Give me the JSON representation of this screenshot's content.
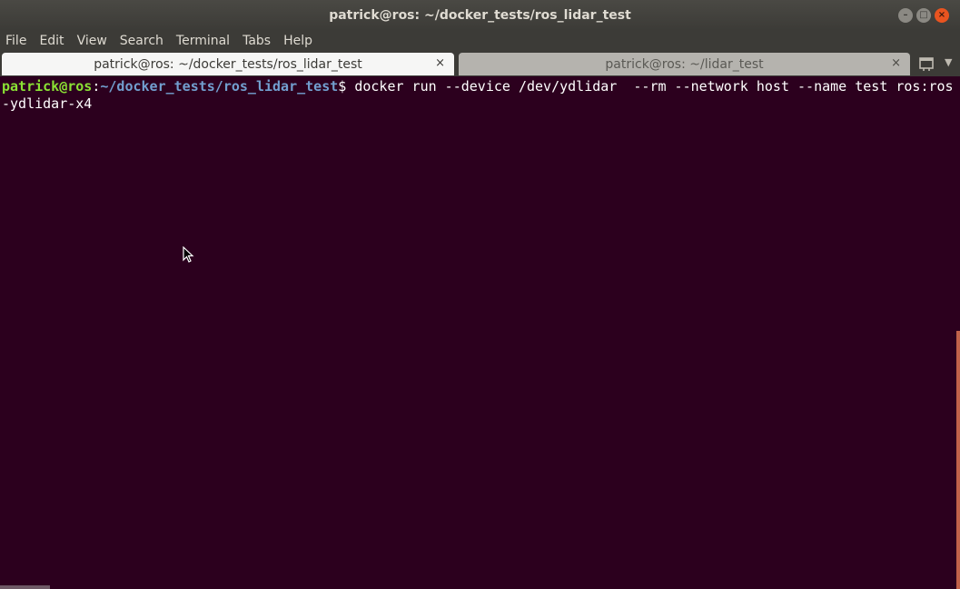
{
  "window": {
    "title": "patrick@ros: ~/docker_tests/ros_lidar_test"
  },
  "menu": [
    "File",
    "Edit",
    "View",
    "Search",
    "Terminal",
    "Tabs",
    "Help"
  ],
  "tabs": [
    {
      "label": "patrick@ros: ~/docker_tests/ros_lidar_test",
      "close": "×",
      "active": true
    },
    {
      "label": "patrick@ros: ~/lidar_test",
      "close": "×",
      "active": false
    }
  ],
  "terminal": {
    "prompt_user": "patrick@ros",
    "prompt_sep": ":",
    "prompt_path": "~/docker_tests/ros_lidar_test",
    "prompt_end": "$ ",
    "command_line1": "docker run --device /dev/ydlidar  --rm --network host --name test ros:ros",
    "command_line2": "-ydlidar-x4"
  },
  "colors": {
    "terminal_bg": "#2c001e",
    "prompt_user": "#8ae234",
    "prompt_path": "#729fcf",
    "close_button": "#e95420"
  }
}
